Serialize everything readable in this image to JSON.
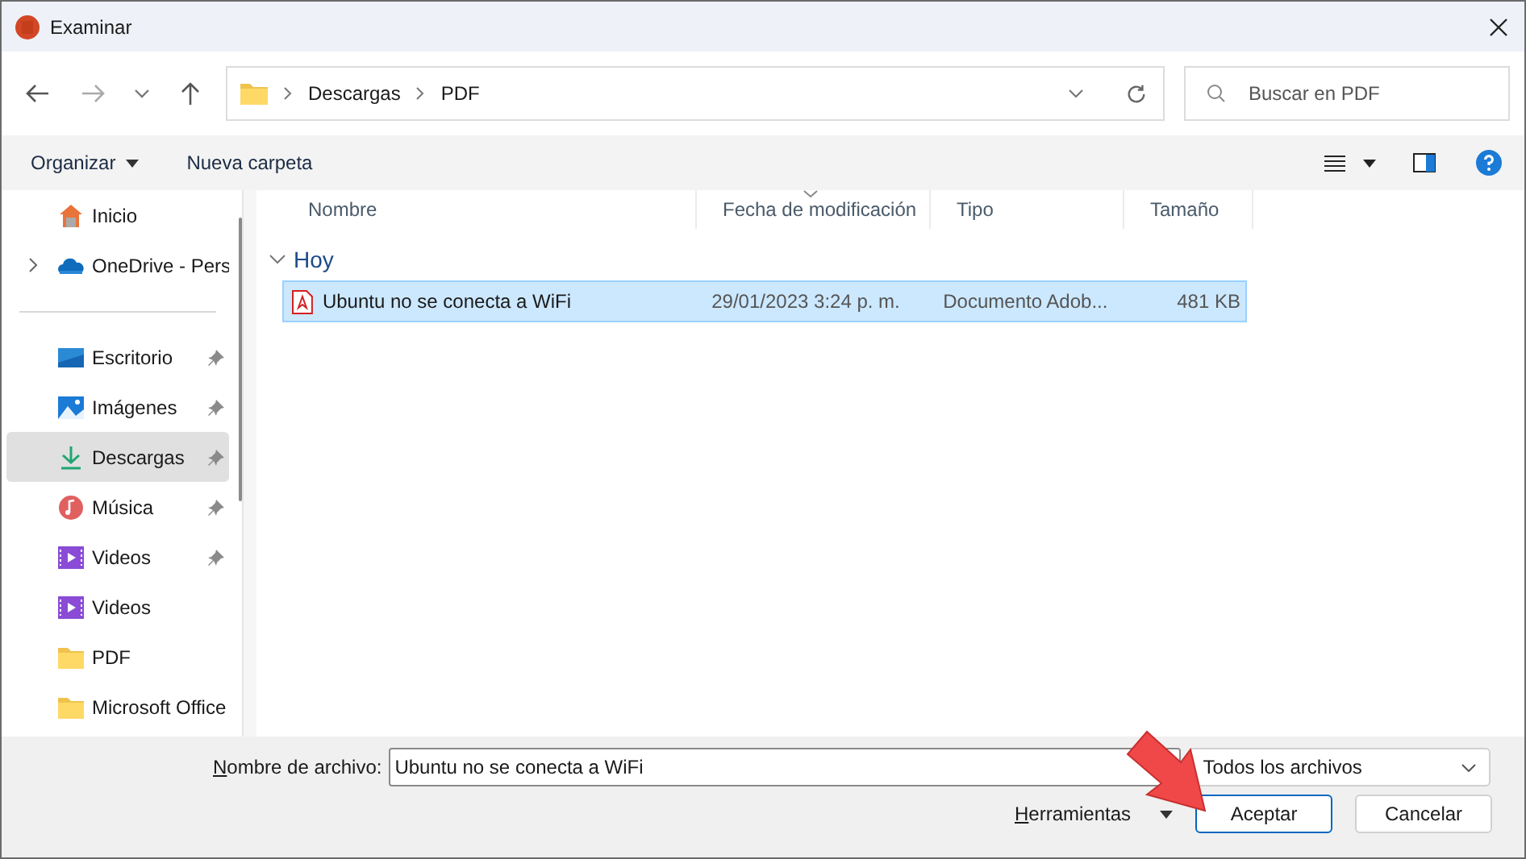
{
  "window": {
    "title": "Examinar"
  },
  "address": {
    "segments": [
      "Descargas",
      "PDF"
    ]
  },
  "search": {
    "placeholder": "Buscar en PDF"
  },
  "toolbar": {
    "organize": "Organizar",
    "new_folder": "Nueva carpeta"
  },
  "sidebar": {
    "top": [
      {
        "label": "Inicio",
        "kind": "home",
        "expandable": false,
        "pinned": false,
        "selected": false
      },
      {
        "label": "OneDrive - Pers",
        "kind": "cloud",
        "expandable": true,
        "pinned": false,
        "selected": false
      }
    ],
    "places": [
      {
        "label": "Escritorio",
        "kind": "desktop",
        "expandable": false,
        "pinned": true,
        "selected": false
      },
      {
        "label": "Imágenes",
        "kind": "pictures",
        "expandable": false,
        "pinned": true,
        "selected": false
      },
      {
        "label": "Descargas",
        "kind": "downloads",
        "expandable": false,
        "pinned": true,
        "selected": true
      },
      {
        "label": "Música",
        "kind": "music",
        "expandable": false,
        "pinned": true,
        "selected": false
      },
      {
        "label": "Videos",
        "kind": "videos",
        "expandable": false,
        "pinned": true,
        "selected": false
      },
      {
        "label": "Videos",
        "kind": "videos",
        "expandable": false,
        "pinned": false,
        "selected": false
      },
      {
        "label": "PDF",
        "kind": "folder",
        "expandable": false,
        "pinned": false,
        "selected": false
      },
      {
        "label": "Microsoft Office",
        "kind": "folder",
        "expandable": false,
        "pinned": false,
        "selected": false
      }
    ]
  },
  "columns": [
    {
      "label": "Nombre",
      "sorted": false
    },
    {
      "label": "Fecha de modificación",
      "sorted": true
    },
    {
      "label": "Tipo",
      "sorted": false
    },
    {
      "label": "Tamaño",
      "sorted": false
    }
  ],
  "groups": [
    {
      "label": "Hoy",
      "expanded": true,
      "rows": [
        {
          "name": "Ubuntu no se conecta a WiFi",
          "date": "29/01/2023 3:24 p. m.",
          "type": "Documento Adob...",
          "size": "481 KB",
          "selected": true
        }
      ]
    }
  ],
  "footer": {
    "filename_label": "Nombre de archivo:",
    "filename": "Ubuntu no se conecta a WiFi",
    "filetype": "Todos los archivos",
    "tools": "Herramientas",
    "buttons": [
      {
        "label": "Aceptar",
        "default": true
      },
      {
        "label": "Cancelar",
        "default": false
      }
    ]
  }
}
